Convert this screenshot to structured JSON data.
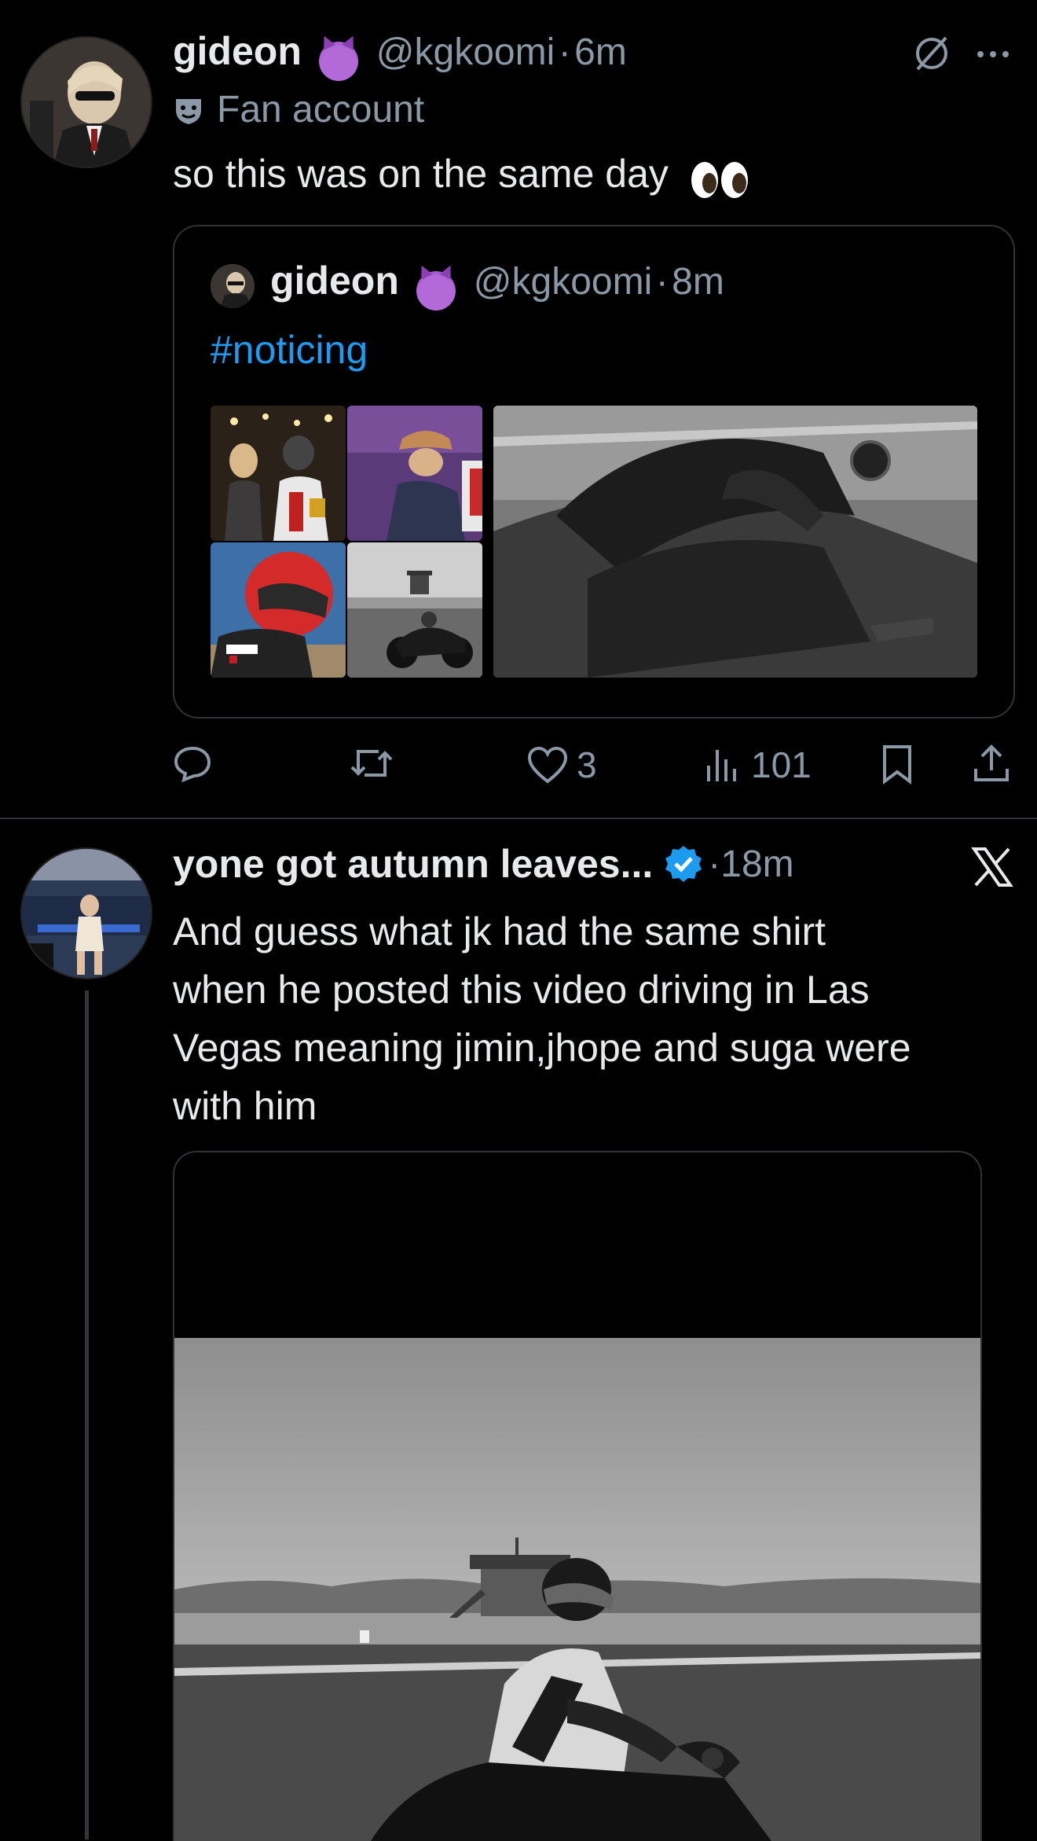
{
  "tweet1": {
    "display_name": "gideon",
    "handle": "@kgkoomi",
    "time": "6m",
    "label": "Fan account",
    "text": "so this was on the same day",
    "quote": {
      "display_name": "gideon",
      "handle": "@kgkoomi",
      "time": "8m",
      "hashtag": "#noticing"
    },
    "actions": {
      "replies": "",
      "retweets": "",
      "likes": "3",
      "views": "101"
    }
  },
  "tweet2": {
    "display_name": "yone got autumn leaves...",
    "time": "18m",
    "text_lines": [
      "And guess what jk had the same shirt",
      "when he posted this video driving in Las",
      "Vegas meaning jimin,jhope and suga were",
      "with him"
    ]
  },
  "colors": {
    "background": "#000000",
    "text": "#e7e9ea",
    "muted": "#8b98a5",
    "link": "#1d9bf0",
    "border": "#2f3336"
  },
  "icons": [
    "grok-icon",
    "more-icon",
    "reply-icon",
    "retweet-icon",
    "like-icon",
    "views-icon",
    "bookmark-icon",
    "share-icon",
    "x-logo-icon",
    "verified-icon",
    "fan-account-icon",
    "devil-emoji-icon",
    "eyes-emoji-icon"
  ]
}
